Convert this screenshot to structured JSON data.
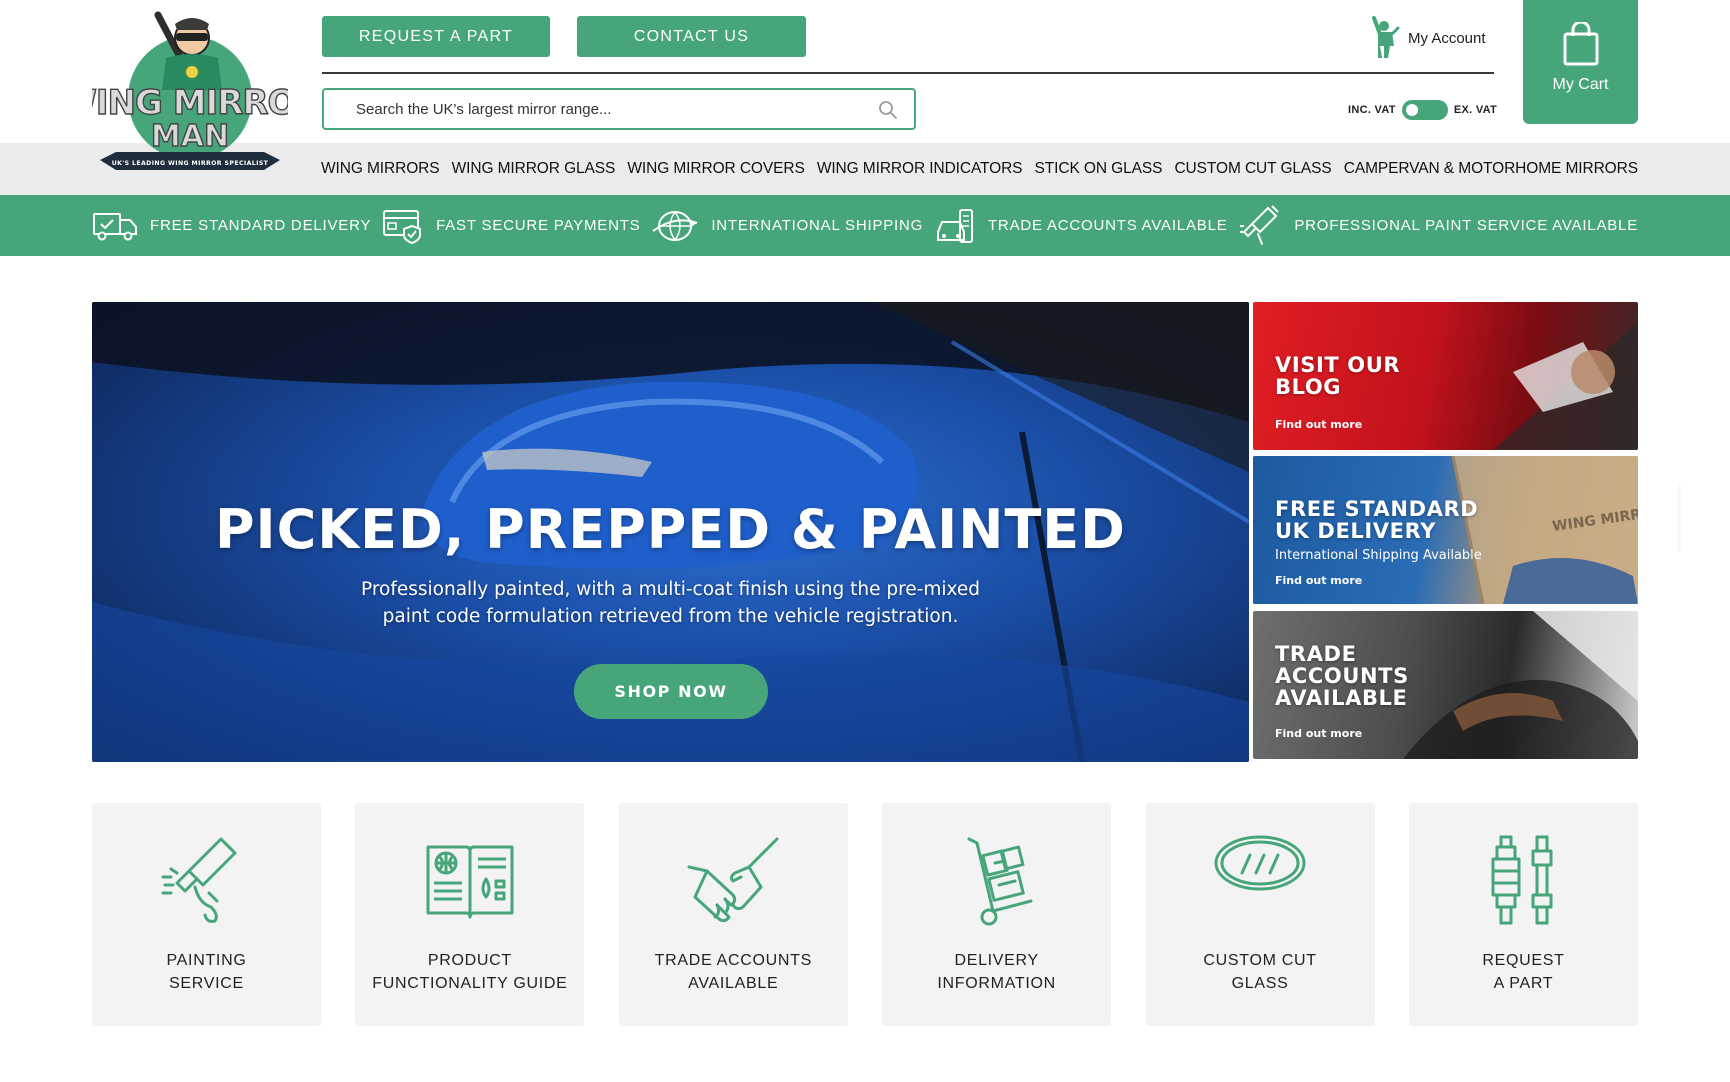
{
  "brand": {
    "logo_line1": "WING MIRROR",
    "logo_line2": "MAN",
    "logo_tagline": "UK'S LEADING WING MIRROR SPECIALIST",
    "accent_color": "#46a67a"
  },
  "header": {
    "request_label": "REQUEST A PART",
    "contact_label": "CONTACT US",
    "search_placeholder": "Search the UK's largest mirror range...",
    "account_label": "My Account",
    "vat_inc": "INC. VAT",
    "vat_ex": "EX. VAT",
    "cart_label": "My Cart"
  },
  "nav": {
    "items": [
      "WING MIRRORS",
      "WING MIRROR GLASS",
      "WING MIRROR COVERS",
      "WING MIRROR INDICATORS",
      "STICK ON GLASS",
      "CUSTOM CUT GLASS",
      "CAMPERVAN & MOTORHOME MIRRORS"
    ]
  },
  "benefits": [
    {
      "label": "FREE STANDARD DELIVERY",
      "icon": "delivery-truck-icon"
    },
    {
      "label": "FAST SECURE PAYMENTS",
      "icon": "secure-card-icon"
    },
    {
      "label": "INTERNATIONAL SHIPPING",
      "icon": "globe-plane-icon"
    },
    {
      "label": "TRADE ACCOUNTS AVAILABLE",
      "icon": "trade-car-icon"
    },
    {
      "label": "PROFESSIONAL PAINT SERVICE AVAILABLE",
      "icon": "spray-gun-icon"
    }
  ],
  "hero": {
    "title": "PICKED, PREPPED & PAINTED",
    "subtitle_line1": "Professionally painted, with a multi-coat finish using the pre-mixed",
    "subtitle_line2": "paint code formulation retrieved from the vehicle registration.",
    "cta": "SHOP NOW"
  },
  "promos": [
    {
      "title_line1": "VISIT OUR",
      "title_line2": "BLOG",
      "link": "Find out more"
    },
    {
      "title_line1": "FREE STANDARD",
      "title_line2": "UK DELIVERY",
      "subtitle": "International Shipping Available",
      "link": "Find out more"
    },
    {
      "title_line1": "TRADE",
      "title_line2": "ACCOUNTS",
      "title_line3": "AVAILABLE",
      "link": "Find out more"
    }
  ],
  "cards": [
    {
      "line1": "PAINTING",
      "line2": "SERVICE",
      "icon": "spray-gun-icon"
    },
    {
      "line1": "PRODUCT",
      "line2": "FUNCTIONALITY GUIDE",
      "icon": "open-book-icon"
    },
    {
      "line1": "TRADE ACCOUNTS",
      "line2": "AVAILABLE",
      "icon": "handshake-icon"
    },
    {
      "line1": "DELIVERY",
      "line2": "INFORMATION",
      "icon": "hand-truck-icon"
    },
    {
      "line1": "CUSTOM CUT",
      "line2": "GLASS",
      "icon": "mirror-glass-icon"
    },
    {
      "line1": "REQUEST",
      "line2": "A PART",
      "icon": "mirror-part-icon"
    }
  ]
}
